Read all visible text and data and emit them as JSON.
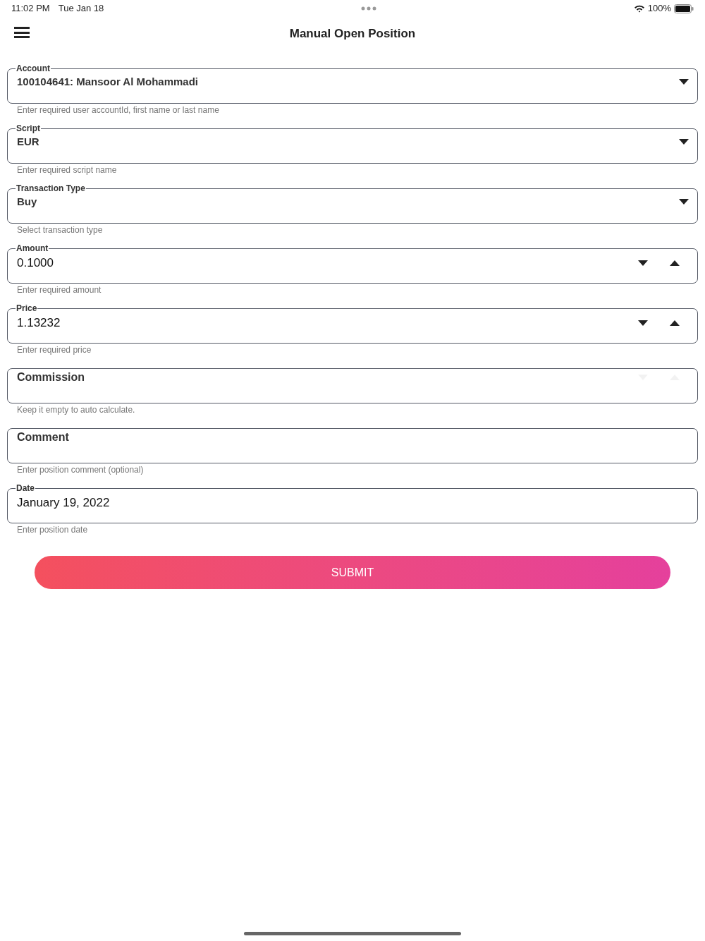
{
  "status_bar": {
    "time": "11:02 PM",
    "date": "Tue Jan 18",
    "battery": "100%"
  },
  "header": {
    "title": "Manual Open Position"
  },
  "fields": [
    {
      "kind": "select",
      "label": "Account",
      "value": "100104641: Mansoor Al Mohammadi",
      "helper": "Enter required user accountId, first name or last name"
    },
    {
      "kind": "select",
      "label": "Script",
      "value": "EUR",
      "helper": "Enter required script name"
    },
    {
      "kind": "select",
      "label": "Transaction Type",
      "value": "Buy",
      "helper": "Select transaction type"
    },
    {
      "kind": "number",
      "label": "Amount",
      "value": "0.1000",
      "helper": "Enter required amount"
    },
    {
      "kind": "number",
      "label": "Price",
      "value": "1.13232",
      "helper": "Enter required price"
    },
    {
      "kind": "number",
      "label": "Commission",
      "helper": "Keep it empty to auto calculate."
    },
    {
      "kind": "text",
      "label": "Comment",
      "helper": "Enter position comment (optional)"
    },
    {
      "kind": "text",
      "label": "Date",
      "value": "January 19, 2022",
      "helper": "Enter position date"
    }
  ],
  "submit": {
    "label": "SUBMIT"
  }
}
